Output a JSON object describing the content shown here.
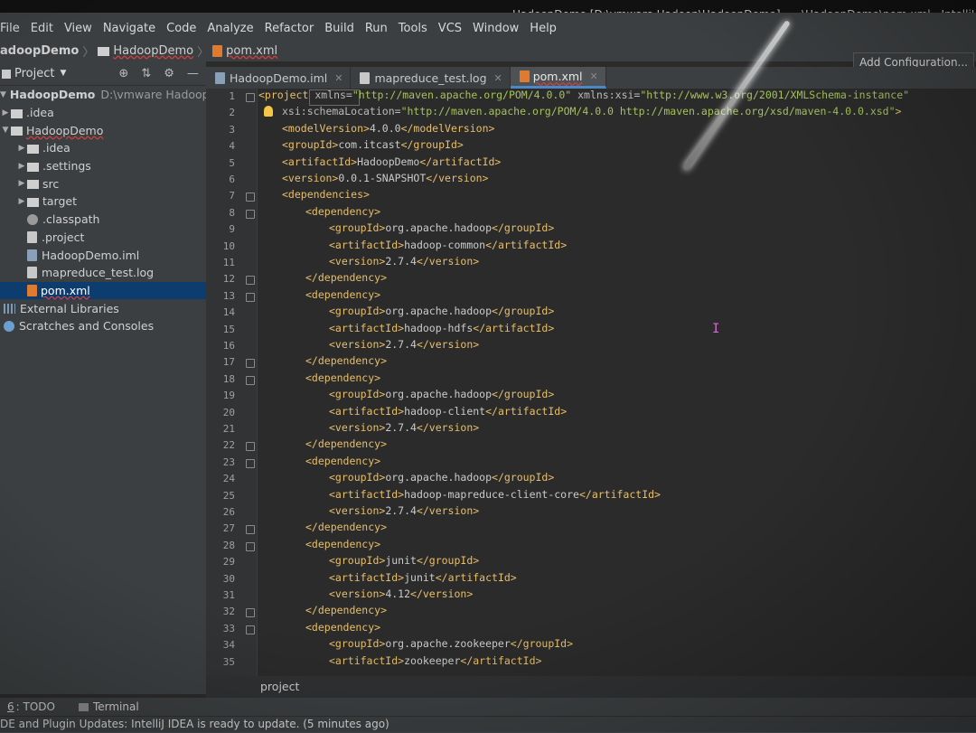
{
  "window": {
    "title": "HadoopDemo [D:\\vmware Hadoop\\HadoopDemo] - ...\\HadoopDemo\\pom.xml - IntelliJ IDEA"
  },
  "menu": [
    "File",
    "Edit",
    "View",
    "Navigate",
    "Code",
    "Analyze",
    "Refactor",
    "Build",
    "Run",
    "Tools",
    "VCS",
    "Window",
    "Help"
  ],
  "breadcrumb": [
    "adoopDemo",
    "HadoopDemo",
    "pom.xml"
  ],
  "toolbar": {
    "add_config": "Add Configuration..."
  },
  "project_panel": {
    "title": "Project",
    "items": [
      {
        "label": "HadoopDemo",
        "path": "D:\\vmware Hadoop\\Ha"
      },
      {
        "label": ".idea"
      },
      {
        "label": "HadoopDemo"
      },
      {
        "label": ".idea"
      },
      {
        "label": ".settings"
      },
      {
        "label": "src"
      },
      {
        "label": "target"
      },
      {
        "label": ".classpath"
      },
      {
        "label": ".project"
      },
      {
        "label": "HadoopDemo.iml"
      },
      {
        "label": "mapreduce_test.log"
      },
      {
        "label": "pom.xml"
      },
      {
        "label": "External Libraries"
      },
      {
        "label": "Scratches and Consoles"
      }
    ]
  },
  "tabs": [
    {
      "label": "HadoopDemo.iml"
    },
    {
      "label": "mapreduce_test.log"
    },
    {
      "label": "pom.xml"
    }
  ],
  "editor": {
    "line_numbers": [
      "1",
      "2",
      "3",
      "4",
      "5",
      "6",
      "7",
      "8",
      "9",
      "10",
      "11",
      "12",
      "13",
      "14",
      "15",
      "16",
      "17",
      "18",
      "19",
      "20",
      "21",
      "22",
      "23",
      "24",
      "25",
      "26",
      "27",
      "28",
      "29",
      "30",
      "31",
      "32",
      "33",
      "34",
      "35"
    ],
    "lines": {
      "l1_tag": "<project",
      "l1_a1": " xmlns=",
      "l1_v1": "\"http://maven.apache.org/POM/4.0.0\"",
      "l1_a2": " xmlns:xsi=",
      "l1_v2": "\"http://www.w3.org/2001/XMLSchema-instance\"",
      "l2_a": "xsi:schemaLocation=",
      "l2_v": "\"http://maven.apache.org/POM/4.0.0 http://maven.apache.org/xsd/maven-4.0.0.xsd\"",
      "l2_end": ">",
      "modelVersion": "4.0.0",
      "groupId": "com.itcast",
      "artifactId": "HadoopDemo",
      "version": "0.0.1-SNAPSHOT",
      "deps": [
        {
          "groupId": "org.apache.hadoop",
          "artifactId": "hadoop-common",
          "version": "2.7.4"
        },
        {
          "groupId": "org.apache.hadoop",
          "artifactId": "hadoop-hdfs",
          "version": "2.7.4"
        },
        {
          "groupId": "org.apache.hadoop",
          "artifactId": "hadoop-client",
          "version": "2.7.4"
        },
        {
          "groupId": "org.apache.hadoop",
          "artifactId": "hadoop-mapreduce-client-core",
          "version": "2.7.4"
        },
        {
          "groupId": "junit",
          "artifactId": "junit",
          "version": "4.12"
        },
        {
          "groupId": "org.apache.zookeeper",
          "artifactId": "zookeeper"
        }
      ]
    },
    "tags": {
      "modelVersion_open": "<modelVersion>",
      "modelVersion_close": "</modelVersion>",
      "groupId_open": "<groupId>",
      "groupId_close": "</groupId>",
      "artifactId_open": "<artifactId>",
      "artifactId_close": "</artifactId>",
      "version_open": "<version>",
      "version_close": "</version>",
      "dependencies_open": "<dependencies>",
      "dependency_open": "<dependency>",
      "dependency_close": "</dependency>"
    }
  },
  "editor_breadcrumb": "project",
  "bottom_tools": [
    {
      "num": "6",
      "label": ": TODO"
    },
    {
      "label": "Terminal"
    }
  ],
  "status": "DE and Plugin Updates: IntelliJ IDEA is ready to update. (5 minutes ago)"
}
